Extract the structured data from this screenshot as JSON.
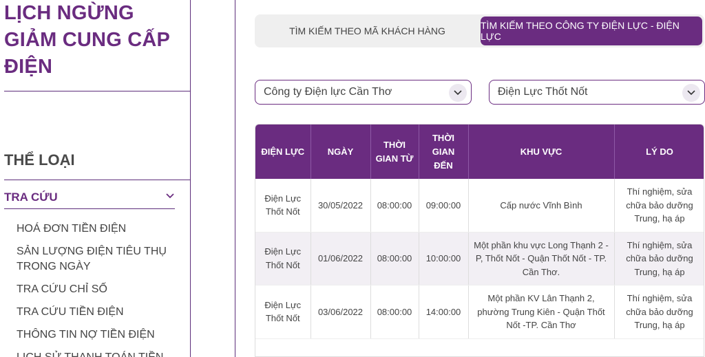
{
  "sidebar": {
    "title": "LỊCH NGỪNG GIẢM CUNG CẤP ĐIỆN",
    "section_heading": "THỂ LOẠI",
    "group_label": "TRA CỨU",
    "menu_items": [
      "HOÁ ĐƠN TIỀN ĐIỆN",
      "SẢN LƯỢNG ĐIỆN TIÊU THỤ TRONG NGÀY",
      "TRA CỨU CHỈ SỐ",
      "TRA CỨU TIỀN ĐIỆN",
      "THÔNG TIN NỢ TIỀN ĐIỆN",
      "LỊCH SỬ THANH TOÁN TIỀN"
    ]
  },
  "tabs": [
    "TÌM KIẾM THEO MÃ KHÁCH HÀNG",
    "TÌM KIẾM THEO CÔNG TY ĐIỆN LỰC - ĐIỆN LỰC"
  ],
  "active_tab": 1,
  "filters": {
    "company": "Công ty Điện lực Cần Thơ",
    "branch": "Điện Lực Thốt Nốt"
  },
  "table": {
    "headers": [
      "ĐIỆN LỰC",
      "NGÀY",
      "THỜI GIAN TỪ",
      "THỜI GIAN ĐẾN",
      "KHU VỰC",
      "LÝ DO"
    ],
    "rows": [
      [
        "Điện Lực Thốt Nốt",
        "30/05/2022",
        "08:00:00",
        "09:00:00",
        "Cấp nước Vĩnh Bình",
        "Thí nghiệm, sửa chữa bảo dưỡng Trung, hạ áp"
      ],
      [
        "Điện Lực Thốt Nốt",
        "01/06/2022",
        "08:00:00",
        "10:00:00",
        "Một phần khu vực Long Thạnh 2 - P, Thốt Nốt - Quận Thốt Nốt - TP. Cần Thơ.",
        "Thí nghiệm, sửa chữa bảo dưỡng Trung, hạ áp"
      ],
      [
        "Điện Lực Thốt Nốt",
        "03/06/2022",
        "08:00:00",
        "14:00:00",
        "Một phần KV Lân Thạnh 2, phường Trung Kiên - Quận Thốt Nốt -TP. Cần Thơ",
        "Thí nghiệm, sửa chữa bảo dưỡng Trung, hạ áp"
      ]
    ]
  },
  "colors": {
    "brand": "#6a2c80",
    "row_alt": "#f2eff4"
  }
}
